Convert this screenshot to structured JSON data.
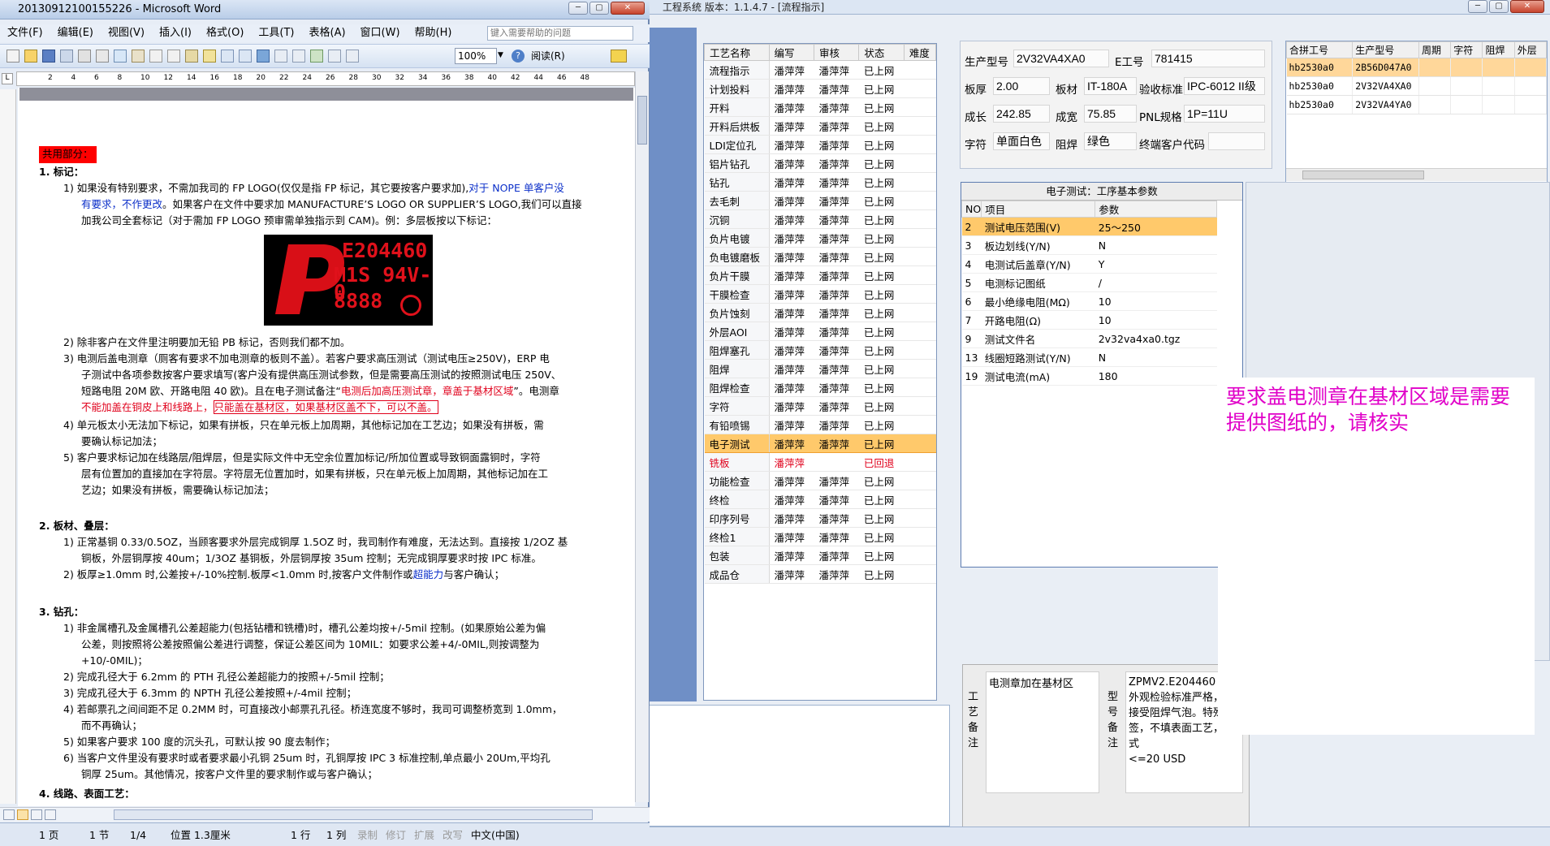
{
  "word": {
    "title": "20130912100155226 - Microsoft Word",
    "menu": [
      "文件(F)",
      "编辑(E)",
      "视图(V)",
      "插入(I)",
      "格式(O)",
      "工具(T)",
      "表格(A)",
      "窗口(W)",
      "帮助(H)"
    ],
    "help_placeholder": "键入需要帮助的问题",
    "zoom": "100%",
    "read_button": "阅读(R)",
    "ruler_ticks": [
      "2",
      "4",
      "6",
      "8",
      "10",
      "12",
      "14",
      "16",
      "18",
      "20",
      "22",
      "24",
      "26",
      "28",
      "30",
      "32",
      "34",
      "36",
      "38",
      "40",
      "42",
      "44",
      "46",
      "48"
    ],
    "status": {
      "page": "1 页",
      "section": "1 节",
      "pages": "1/4",
      "position": "位置 1.3厘米",
      "line": "1 行",
      "col": "1 列",
      "rec": "录制",
      "trk": "修订",
      "ext": "扩展",
      "ovr": "改写",
      "lang": "中文(中国)"
    },
    "doc": {
      "heading": "共用部分：",
      "s1_title": "1.    标记：",
      "s1_1a": "1)  如果没有特别要求，不需加我司的 FP LOGO(仅仅是指 FP 标记，其它要按客户要求加),",
      "s1_1b": "对于 NOPE 单客户没",
      "s1_1c": "有要求，不作更改",
      "s1_1d": "。如果客户在文件中要求加 MANUFACTURE’S LOGO OR SUPPLIER’S LOGO,我们可以直接",
      "s1_1e": "加我公司全套标记（对于需加 FP LOGO 预审需单独指示到 CAM)。例：多层板按以下标记：",
      "logo_e": "E204460",
      "logo_m": "M1S 94V-0",
      "logo_n": "8888",
      "s1_2": "2)  除非客户在文件里注明要加无铅 PB 标记，否则我们都不加。",
      "s1_3a": "3)  电测后盖电测章（厕客有要求不加电测章的板则不盖）。若客户要求高压测试（测试电压≥250V)，ERP 电",
      "s1_3b": "子测试中各项参数按客户要求填写(客户没有提供高压测试参数，但是需要高压测试的按照测试电压 250V、",
      "s1_3c": "短路电阻 20M 欧、开路电阻 40 欧)。且在电子测试备注“",
      "s1_3d": "电测后加高压测试章，章盖于基材区域",
      "s1_3e": "”。电测章",
      "s1_3f": "不能加盖在铜皮上和线路上，",
      "s1_3g": "只能盖在基材区，如果基材区盖不下，可以不盖。",
      "s1_4a": "4)  单元板太小无法加下标记，如果有拼板，只在单元板上加周期，其他标记加在工艺边；如果没有拼板，需",
      "s1_4b": "要确认标记加法；",
      "s1_5a": "5)  客户要求标记加在线路层/阻焊层，但是实际文件中无空余位置加标记/所加位置或导致铜面露铜时，字符",
      "s1_5b": "层有位置加的直接加在字符层。字符层无位置加时，如果有拼板，只在单元板上加周期，其他标记加在工",
      "s1_5c": "艺边；如果没有拼板，需要确认标记加法；",
      "s2_title": "2.    板材、叠层：",
      "s2_1a": "1)  正常基铜 0.33/0.5OZ，当顾客要求外层完成铜厚 1.5OZ 时，我司制作有难度，无法达到。直接按 1/2OZ 基",
      "s2_1b": "铜板，外层铜厚按 40um；1/3OZ 基铜板，外层铜厚按 35um 控制；无完成铜厚要求时按 IPC 标准。",
      "s2_2a": "2)  板厚≥1.0mm 时,公差按+/-10%控制.板厚<1.0mm 时,按客户文件制作或",
      "s2_2b": "超能力",
      "s2_2c": "与客户确认；",
      "s3_title": "3.    钻孔：",
      "s3_1a": "1)  非金属槽孔及金属槽孔公差超能力(包括钻槽和铣槽)时，槽孔公差均按+/-5mil 控制。(如果原始公差为偏",
      "s3_1b": "公差，则按照将公差按照偏公差进行调整，保证公差区间为 10MIL：如要求公差+4/-0MIL,则按调整为",
      "s3_1c": "+10/-0MIL)；",
      "s3_2": "2)  完成孔径大于 6.2mm 的 PTH 孔径公差超能力的按照+/-5mil 控制；",
      "s3_3": "3)  完成孔径大于 6.3mm 的 NPTH 孔径公差按照+/-4mil 控制；",
      "s3_4a": "4)  若邮票孔之间间距不足 0.2MM 时，可直接改小邮票孔孔径。桥连宽度不够时，我司可调整桥宽到 1.0mm，",
      "s3_4b": "而不再确认；",
      "s3_5": "5)  如果客户要求 100 度的沉头孔，可默认按 90 度去制作；",
      "s3_6a": "6)  当客户文件里没有要求时或者要求最小孔铜 25um 时，孔铜厚按 IPC 3 标准控制,单点最小 20Um,平均孔",
      "s3_6b": "铜厚 25um。其他情况，按客户文件里的要求制作或与客户确认；",
      "s4_title": "4.    线路、表面工艺："
    }
  },
  "app": {
    "title": "工程系统    版本：1.1.4.7 - [流程指示]",
    "process_headers": [
      "工艺名称",
      "编写",
      "审核",
      "状态",
      "难度"
    ],
    "process_rows": [
      [
        "流程指示",
        "潘萍萍",
        "潘萍萍",
        "已上网"
      ],
      [
        "计划投料",
        "潘萍萍",
        "潘萍萍",
        "已上网"
      ],
      [
        "开料",
        "潘萍萍",
        "潘萍萍",
        "已上网"
      ],
      [
        "开料后烘板",
        "潘萍萍",
        "潘萍萍",
        "已上网"
      ],
      [
        "LDI定位孔",
        "潘萍萍",
        "潘萍萍",
        "已上网"
      ],
      [
        "铝片钻孔",
        "潘萍萍",
        "潘萍萍",
        "已上网"
      ],
      [
        "钻孔",
        "潘萍萍",
        "潘萍萍",
        "已上网"
      ],
      [
        "去毛刺",
        "潘萍萍",
        "潘萍萍",
        "已上网"
      ],
      [
        "沉铜",
        "潘萍萍",
        "潘萍萍",
        "已上网"
      ],
      [
        "负片电镀",
        "潘萍萍",
        "潘萍萍",
        "已上网"
      ],
      [
        "负电镀磨板",
        "潘萍萍",
        "潘萍萍",
        "已上网"
      ],
      [
        "负片干膜",
        "潘萍萍",
        "潘萍萍",
        "已上网"
      ],
      [
        "干膜检查",
        "潘萍萍",
        "潘萍萍",
        "已上网"
      ],
      [
        "负片蚀刻",
        "潘萍萍",
        "潘萍萍",
        "已上网"
      ],
      [
        "外层AOI",
        "潘萍萍",
        "潘萍萍",
        "已上网"
      ],
      [
        "阻焊塞孔",
        "潘萍萍",
        "潘萍萍",
        "已上网"
      ],
      [
        "阻焊",
        "潘萍萍",
        "潘萍萍",
        "已上网"
      ],
      [
        "阻焊检查",
        "潘萍萍",
        "潘萍萍",
        "已上网"
      ],
      [
        "字符",
        "潘萍萍",
        "潘萍萍",
        "已上网"
      ],
      [
        "有铅喷锡",
        "潘萍萍",
        "潘萍萍",
        "已上网"
      ],
      [
        "电子测试",
        "潘萍萍",
        "潘萍萍",
        "已上网"
      ],
      [
        "铣板",
        "潘萍萍",
        "",
        "已回退"
      ],
      [
        "功能检查",
        "潘萍萍",
        "潘萍萍",
        "已上网"
      ],
      [
        "终检",
        "潘萍萍",
        "潘萍萍",
        "已上网"
      ],
      [
        "印序列号",
        "潘萍萍",
        "潘萍萍",
        "已上网"
      ],
      [
        "终检1",
        "潘萍萍",
        "潘萍萍",
        "已上网"
      ],
      [
        "包装",
        "潘萍萍",
        "潘萍萍",
        "已上网"
      ],
      [
        "成品仓",
        "潘萍萍",
        "潘萍萍",
        "已上网"
      ]
    ],
    "info": {
      "model_label": "生产型号",
      "model": "2V32VA4XA0",
      "eno_label": "E工号",
      "eno": "781415",
      "thick_label": "板厚",
      "thick": "2.00",
      "mat_label": "板材",
      "mat": "IT-180A",
      "std_label": "验收标准",
      "std": "IPC-6012 II级",
      "len_label": "成长",
      "len": "242.85",
      "wid_label": "成宽",
      "wid": "75.85",
      "pnl_label": "PNL规格",
      "pnl": "1P=11U",
      "char_label": "字符",
      "char": "单面白色",
      "mask_label": "阻焊",
      "mask": "绿色",
      "cust_label": "终端客户代码",
      "cust": ""
    },
    "combine_headers": [
      "合拼工号",
      "生产型号",
      "周期",
      "字符",
      "阻焊",
      "外层"
    ],
    "combine_rows": [
      [
        "hb2530a0",
        "2B56D047A0"
      ],
      [
        "hb2530a0",
        "2V32VA4XA0"
      ],
      [
        "hb2530a0",
        "2V32VA4YA0"
      ]
    ],
    "param_caption": "电子测试：工序基本参数",
    "param_headers": [
      "NO",
      "项目",
      "参数"
    ],
    "param_rows": [
      [
        "2",
        "测试电压范围(V)",
        "25～250"
      ],
      [
        "3",
        "板边划线(Y/N)",
        "N"
      ],
      [
        "4",
        "电测试后盖章(Y/N)",
        "Y"
      ],
      [
        "5",
        "电测标记图纸",
        "/"
      ],
      [
        "6",
        "最小绝缘电阻(MΩ)",
        "10"
      ],
      [
        "7",
        "开路电阻(Ω)",
        "10"
      ],
      [
        "9",
        "测试文件名",
        "2v32va4xa0.tgz"
      ],
      [
        "13",
        "线圈短路测试(Y/N)",
        "N"
      ],
      [
        "19",
        "测试电流(mA)",
        "180"
      ]
    ],
    "note_label_a": "工艺备注",
    "note_text_a": "电测章加在基材区",
    "note_label_b": "型号备注",
    "note_text_b": "ZPMV2.E204460\n外观检验标准严格，不接受阻焊气泡。特殊标签，不填表面工艺，形式\n<=20 USD",
    "overlay_text": "要求盖电测章在基材区域是需要提供图纸的，请核实"
  }
}
